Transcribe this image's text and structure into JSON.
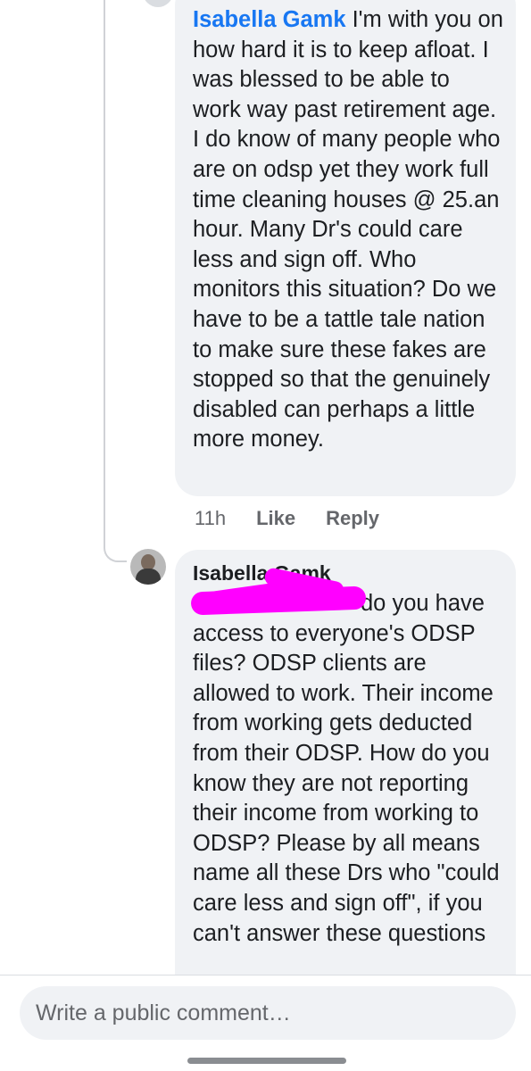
{
  "comment_1": {
    "author": "Isabella Gamk",
    "text": " I'm with you on how hard it is to keep afloat. I was blessed to be able to work way past retirement age. I do know of many people who are on odsp yet they work full time cleaning houses @ 25.an hour. Many Dr's could care less and sign off. Who monitors this situation? Do we have to be a tattle tale nation  to make sure these fakes are stopped so that the genuinely disabled can perhaps a little more money.",
    "time": "11h",
    "like_label": "Like",
    "reply_label": "Reply"
  },
  "comment_2": {
    "author": "Isabella Gamk",
    "text": "do you have access to everyone's ODSP files? ODSP clients are allowed to work. Their income from working gets deducted from their ODSP. How do you know they are not reporting their income from working to ODSP? Please by all means name all these Drs who \"could care less and sign off\", if you can't answer these questions"
  },
  "composer": {
    "placeholder": "Write a public comment…"
  },
  "colors": {
    "author_link": "#1877f2",
    "bubble_bg": "#f0f2f5",
    "redaction": "#ff00ff"
  }
}
